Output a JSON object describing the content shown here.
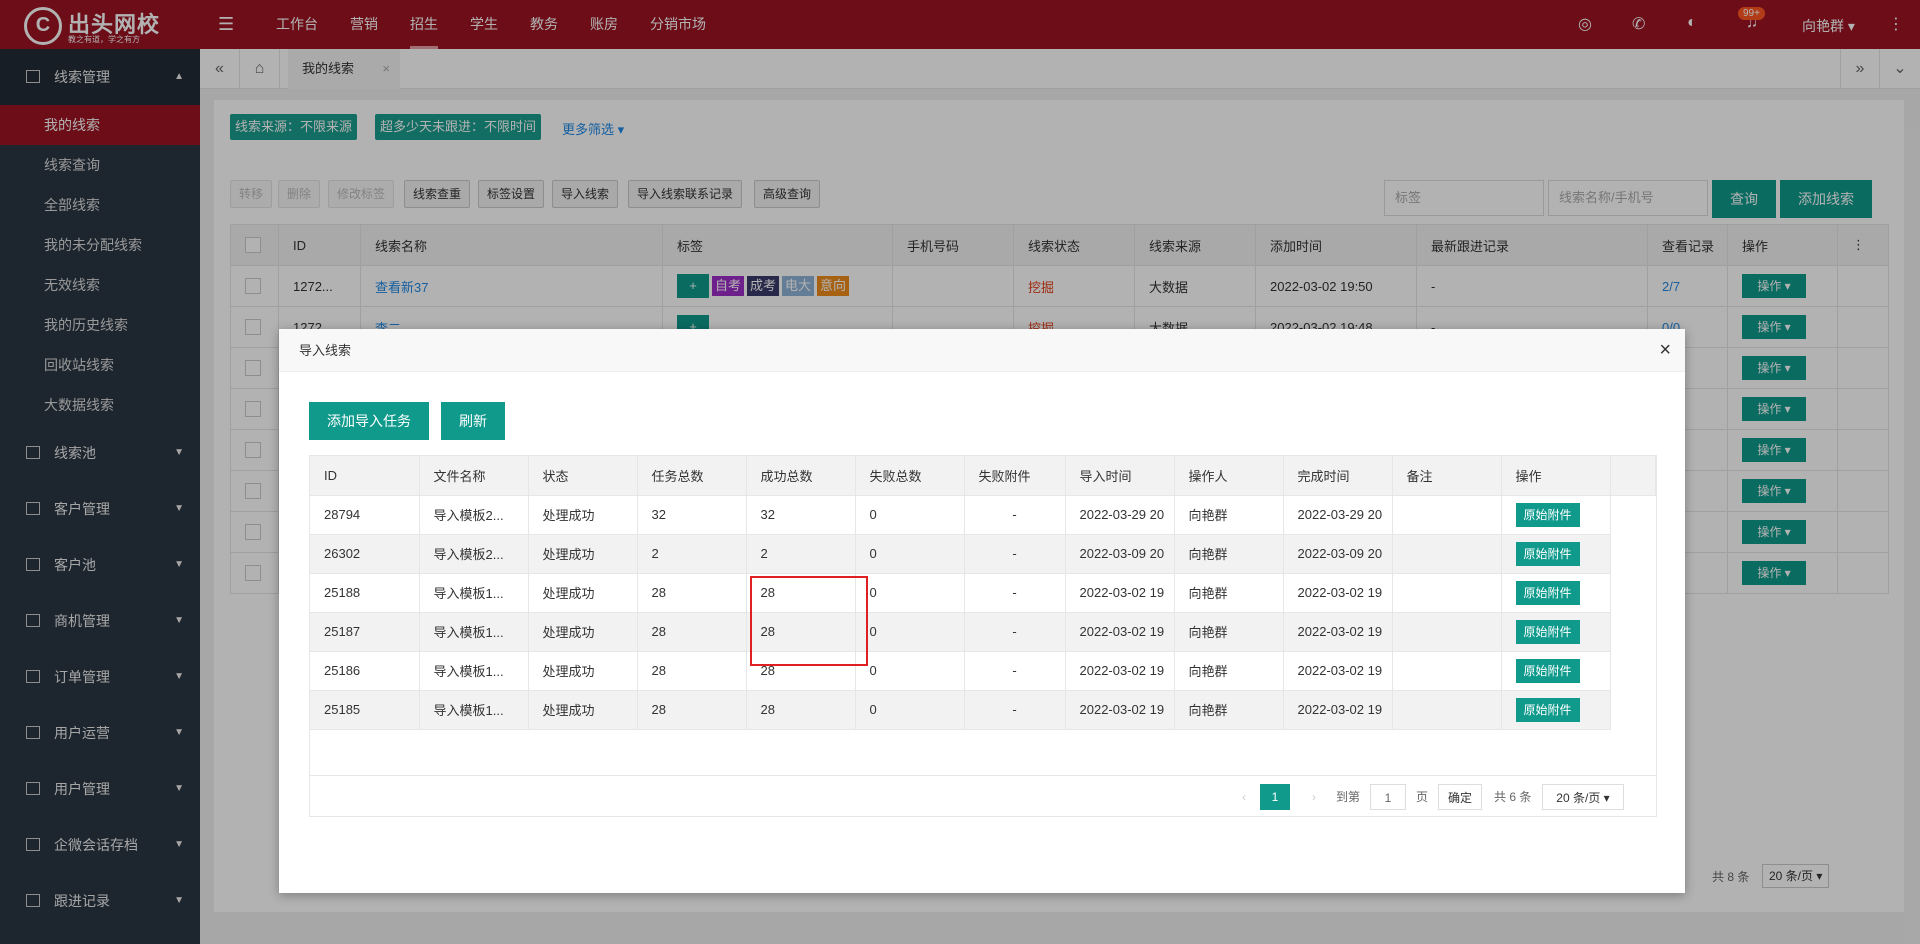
{
  "header": {
    "logo_glyph": "C",
    "logo_name": "出头网校",
    "logo_slogan": "教之有道，学之有方",
    "nav": [
      "工作台",
      "营销",
      "招生",
      "学生",
      "教务",
      "账房",
      "分销市场"
    ],
    "active_nav": "招生",
    "notification_badge": "99+",
    "user_name": "向艳群"
  },
  "sidebar": {
    "groups": [
      {
        "label": "线索管理",
        "icon": "list-icon",
        "expanded": true,
        "items": [
          "我的线索",
          "线索查询",
          "全部线索",
          "我的未分配线索",
          "无效线索",
          "我的历史线索",
          "回收站线索",
          "大数据线索"
        ]
      },
      {
        "label": "线索池"
      },
      {
        "label": "客户管理"
      },
      {
        "label": "客户池"
      },
      {
        "label": "商机管理"
      },
      {
        "label": "订单管理"
      },
      {
        "label": "用户运营"
      },
      {
        "label": "用户管理"
      },
      {
        "label": "企微会话存档"
      },
      {
        "label": "跟进记录"
      }
    ]
  },
  "tabs": {
    "active": "我的线索"
  },
  "filters": {
    "chips": [
      "线索来源：不限来源",
      "超多少天未跟进：不限时间"
    ],
    "more": "更多筛选"
  },
  "toolbar": {
    "disabled": [
      "转移",
      "删除",
      "修改标签"
    ],
    "buttons": [
      "线索查重",
      "标签设置",
      "导入线索",
      "导入线索联系记录",
      "高级查询"
    ],
    "tag_placeholder": "标签",
    "search_placeholder": "线索名称/手机号",
    "query": "查询",
    "add": "添加线索"
  },
  "clue_table": {
    "headers": [
      "ID",
      "线索名称",
      "标签",
      "手机号码",
      "线索状态",
      "线索来源",
      "添加时间",
      "最新跟进记录",
      "查看记录",
      "操作"
    ],
    "rows": [
      {
        "id": "1272...",
        "name": "查看新37",
        "tags": [
          "自考",
          "成考",
          "电大",
          "意向"
        ],
        "status": "挖掘",
        "source": "大数据",
        "time": "2022-03-02 19:50",
        "follow": "-",
        "views": "2/7",
        "op": "操作"
      },
      {
        "id": "1272...",
        "name": "李二",
        "tags": [],
        "status": "挖掘",
        "source": "大数据",
        "time": "2022-03-02 19:48",
        "follow": "-",
        "views": "0/0",
        "op": "操作"
      }
    ],
    "op_label": "操作",
    "total": "共 8 条",
    "page_size": "20 条/页"
  },
  "modal": {
    "title": "导入线索",
    "add_task": "添加导入任务",
    "refresh": "刷新",
    "headers": [
      "ID",
      "文件名称",
      "状态",
      "任务总数",
      "成功总数",
      "失败总数",
      "失败附件",
      "导入时间",
      "操作人",
      "完成时间",
      "备注",
      "操作"
    ],
    "rows": [
      {
        "id": "28794",
        "file": "导入模板2...",
        "status": "处理成功",
        "total": "32",
        "success": "32",
        "fail": "0",
        "attach": "-",
        "import_time": "2022-03-29 20",
        "operator": "向艳群",
        "done_time": "2022-03-29 20",
        "note": "",
        "op": "原始附件"
      },
      {
        "id": "26302",
        "file": "导入模板2...",
        "status": "处理成功",
        "total": "2",
        "success": "2",
        "fail": "0",
        "attach": "-",
        "import_time": "2022-03-09 20",
        "operator": "向艳群",
        "done_time": "2022-03-09 20",
        "note": "",
        "op": "原始附件"
      },
      {
        "id": "25188",
        "file": "导入模板1...",
        "status": "处理成功",
        "total": "28",
        "success": "28",
        "fail": "0",
        "attach": "-",
        "import_time": "2022-03-02 19",
        "operator": "向艳群",
        "done_time": "2022-03-02 19",
        "note": "",
        "op": "原始附件"
      },
      {
        "id": "25187",
        "file": "导入模板1...",
        "status": "处理成功",
        "total": "28",
        "success": "28",
        "fail": "0",
        "attach": "-",
        "import_time": "2022-03-02 19",
        "operator": "向艳群",
        "done_time": "2022-03-02 19",
        "note": "",
        "op": "原始附件"
      },
      {
        "id": "25186",
        "file": "导入模板1...",
        "status": "处理成功",
        "total": "28",
        "success": "28",
        "fail": "0",
        "attach": "-",
        "import_time": "2022-03-02 19",
        "operator": "向艳群",
        "done_time": "2022-03-02 19",
        "note": "",
        "op": "原始附件"
      },
      {
        "id": "25185",
        "file": "导入模板1...",
        "status": "处理成功",
        "total": "28",
        "success": "28",
        "fail": "0",
        "attach": "-",
        "import_time": "2022-03-02 19",
        "operator": "向艳群",
        "done_time": "2022-03-02 19",
        "note": "",
        "op": "原始附件"
      }
    ],
    "pager": {
      "current": "1",
      "goto": "到第",
      "page_input": "1",
      "page_unit": "页",
      "confirm": "确定",
      "total": "共 6 条",
      "size": "20 条/页"
    }
  },
  "colors": {
    "brand": "#9b1423",
    "accent": "#0f9a8c",
    "highlight": "#e02020"
  }
}
